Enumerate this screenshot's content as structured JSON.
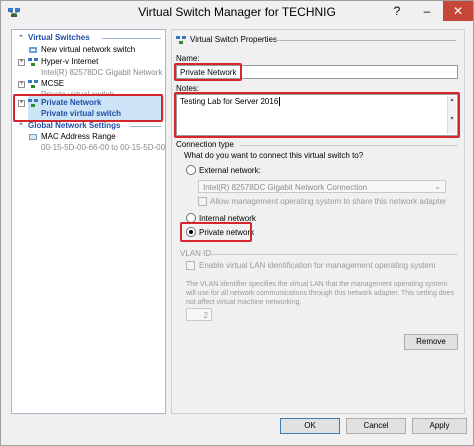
{
  "window": {
    "title": "Virtual Switch Manager for TECHNIG",
    "help": "?",
    "minimize": "–",
    "close": "✕"
  },
  "left": {
    "virtual_switches_head": "Virtual Switches",
    "new_switch": "New virtual network switch",
    "switches": [
      {
        "name": "Hyper-v Internet",
        "sub": "Intel(R) 82578DC Gigabit Network ..."
      },
      {
        "name": "MCSE",
        "sub": "Private virtual switch"
      },
      {
        "name": "Private Network",
        "sub": "Private virtual switch"
      }
    ],
    "global_head": "Global Network Settings",
    "mac": {
      "name": "MAC Address Range",
      "sub": "00-15-5D-00-66-00 to 00-15-5D-00-..."
    }
  },
  "right": {
    "header": "Virtual Switch Properties",
    "name_label": "Name:",
    "name_value": "Private Network",
    "notes_label": "Notes:",
    "notes_value": "Testing Lab for Server 2016",
    "connection_type": "Connection type",
    "question": "What do you want to connect this virtual switch to?",
    "external": "External network:",
    "adapter": "Intel(R) 82578DC Gigabit Network Connection",
    "allow_mgmt": "Allow management operating system to share this network adapter",
    "internal": "Internal network",
    "private": "Private network",
    "vlan_title": "VLAN ID",
    "vlan_enable": "Enable virtual LAN identification for management operating system",
    "vlan_desc": "The VLAN identifier specifies the virtual LAN that the management operating system will use for all network communications through this network adapter. This setting does not affect virtual machine networking.",
    "vlan_value": "2",
    "remove": "Remove",
    "selected_connection": "private"
  },
  "footer": {
    "ok": "OK",
    "cancel": "Cancel",
    "apply": "Apply"
  }
}
